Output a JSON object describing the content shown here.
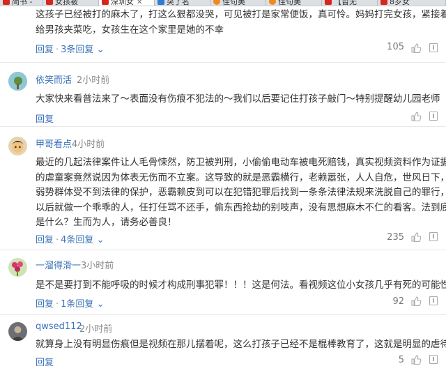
{
  "browser": {
    "tabs": [
      {
        "label": "简书 - ",
        "icon": "jianshu-favicon",
        "color": "#d9261c",
        "active": false
      },
      {
        "label": "女孩被",
        "icon": "jianshu-favicon",
        "color": "#d9261c",
        "active": false
      },
      {
        "label": "深圳女",
        "icon": "jianshu-favicon",
        "color": "#d9261c",
        "active": true
      },
      {
        "label": "突了名",
        "icon": "generic-favicon",
        "color": "#2f7cd3",
        "active": false
      },
      {
        "label": "佳句美",
        "icon": "orange-favicon",
        "color": "#f08a1c",
        "active": false
      },
      {
        "label": "佳句美",
        "icon": "orange-favicon",
        "color": "#f08a1c",
        "active": false
      },
      {
        "label": "【暂无",
        "icon": "jianshu-favicon",
        "color": "#d9261c",
        "active": false
      },
      {
        "label": "8岁女",
        "icon": "jianshu-favicon",
        "color": "#d9261c",
        "active": false
      }
    ]
  },
  "comments": [
    {
      "user": "",
      "time": "",
      "lines": [
        "这孩子已经被打的麻木了，打这么狠都没哭，可见被打是家常便饭，真可怜。妈妈打完女孩，紧接着",
        "给男孩夹菜吃，女孩生在这个家里是她的不幸"
      ],
      "reply_label": "回复",
      "replies_label": "3条回复",
      "likes": "105"
    },
    {
      "user": "依笑而活",
      "time": "2小时前",
      "lines": [
        "大家快来看普法来了～表面没有伤痕不犯法的～我们以后要记住打孩子敲门～特别提醒幼儿园老师"
      ],
      "reply_label": "回复",
      "replies_label": "",
      "likes": ""
    },
    {
      "user": "甲哥看点",
      "time": "4小时前",
      "lines": [
        "最近的几起法律案件让人毛骨悚然，防卫被判刑，小偷偷电动车被电死赔钱，真实视频资料作为证据",
        "的虐童案竟然说因为体表无伤而不立案。这导致的就是恶霸横行，老赖嚣张，人人自危，世风日下，",
        "弱势群体受不到法律的保护，恶霸赖皮到可以在犯错犯罪后找到一条条法律法规来洗脱自己的罪行，",
        "以后就做一个乖乖的人，任打任骂不还手，偷东西抢劫的别吱声，没有思想麻木不仁的看客。法到底",
        "是什么？生而为人，请务必善良！"
      ],
      "reply_label": "回复",
      "replies_label": "4条回复",
      "likes": "235"
    },
    {
      "user": "一溜得滑一",
      "time": "3小时前",
      "lines": [
        "是不是要打到不能呼吸的时候才构成刑事犯罪！！！这是何法。看视频这位小女孩几乎有死的可能性"
      ],
      "reply_label": "回复",
      "replies_label": "1条回复",
      "likes": "92"
    },
    {
      "user": "qwsed112",
      "time": "2小时前",
      "lines": [
        "就算身上没有明显伤痕但是视频在那儿摆着呢，这么打孩子已经不是棍棒教育了，这就是明显的虐待"
      ],
      "reply_label": "回复",
      "replies_label": "",
      "likes": "5"
    }
  ],
  "colors": {
    "link": "#3b73b9",
    "text": "#333333",
    "meta": "#888888"
  }
}
